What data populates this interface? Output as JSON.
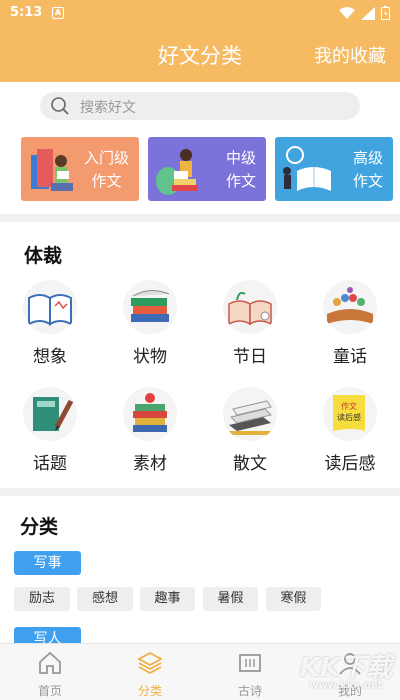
{
  "status_bar": {
    "time": "5:13",
    "notification_letter": "A"
  },
  "header": {
    "title": "好文分类",
    "right_link": "我的收藏"
  },
  "search": {
    "placeholder": "搜索好文"
  },
  "levels": [
    {
      "label": "入门级\n作文"
    },
    {
      "label": "中级\n作文"
    },
    {
      "label": "高级\n作文"
    }
  ],
  "genre": {
    "title": "体裁",
    "items": [
      {
        "label": "想象",
        "icon": "open-book-icon"
      },
      {
        "label": "状物",
        "icon": "book-stack-icon"
      },
      {
        "label": "节日",
        "icon": "plant-book-icon"
      },
      {
        "label": "童话",
        "icon": "fairy-tale-book-icon"
      },
      {
        "label": "话题",
        "icon": "green-book-pencil-icon"
      },
      {
        "label": "素材",
        "icon": "apple-books-icon"
      },
      {
        "label": "散文",
        "icon": "paper-stack-icon"
      },
      {
        "label": "读后感",
        "icon": "reading-note-icon"
      }
    ],
    "reading_note_text": "作文\n读后感"
  },
  "category": {
    "title": "分类",
    "groups": [
      {
        "head": "写事",
        "chips": [
          "励志",
          "感想",
          "趣事",
          "暑假",
          "寒假"
        ]
      },
      {
        "head": "写人"
      }
    ]
  },
  "bottom_nav": [
    {
      "label": "首页",
      "icon": "home-icon"
    },
    {
      "label": "分类",
      "icon": "layers-icon",
      "active": true
    },
    {
      "label": "古诗",
      "icon": "scroll-icon"
    },
    {
      "label": "我的",
      "icon": "user-icon"
    }
  ],
  "watermark": {
    "text": "KK下载",
    "sub": "www.kkx.net"
  },
  "colors": {
    "header": "#f6bb62",
    "active_nav": "#f4ae48",
    "tag": "#3fa0f0"
  }
}
